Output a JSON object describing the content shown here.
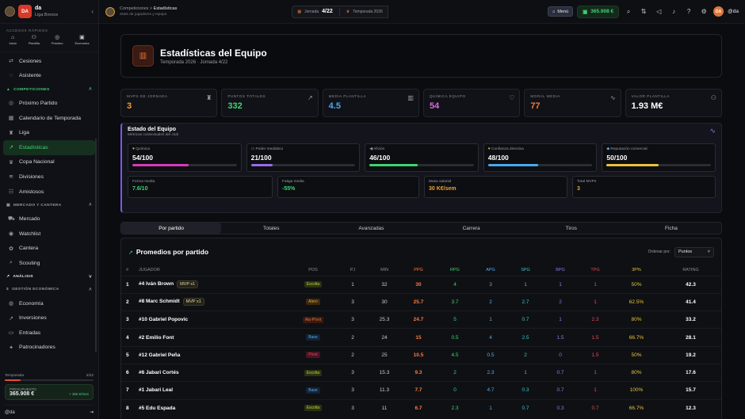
{
  "sidebar": {
    "club_logo": "DA",
    "club_name": "da",
    "club_league": "Liga Bronce",
    "quick_access_title": "ACCESOS RÁPIDOS",
    "quick_access": [
      {
        "label": "Inicio",
        "icon": "home-icon"
      },
      {
        "label": "Plantilla",
        "icon": "users-icon"
      },
      {
        "label": "Próximo",
        "icon": "ball-icon"
      },
      {
        "label": "Economía",
        "icon": "wallet-icon"
      }
    ],
    "items_top": [
      {
        "label": "Cesiones",
        "icon": "swap-icon"
      },
      {
        "label": "Asistente",
        "icon": "assistant-icon"
      }
    ],
    "section_competitions": "COMPETICIONES",
    "items_comp": [
      {
        "label": "Próximo Partido",
        "icon": "ball-icon"
      },
      {
        "label": "Calendario de Temporada",
        "icon": "calendar-icon"
      },
      {
        "label": "Liga",
        "icon": "trophy-icon"
      },
      {
        "label": "Estadísticas",
        "icon": "chart-icon"
      },
      {
        "label": "Copa Nacional",
        "icon": "cup-icon"
      },
      {
        "label": "Divisiones",
        "icon": "layers-icon"
      },
      {
        "label": "Amistosos",
        "icon": "handshake-icon"
      }
    ],
    "section_market": "MERCADO Y CANTERA",
    "items_market": [
      {
        "label": "Mercado",
        "icon": "cart-icon"
      },
      {
        "label": "Watchlist",
        "icon": "eye-icon"
      },
      {
        "label": "Cantera",
        "icon": "sprout-icon"
      },
      {
        "label": "Scouting",
        "icon": "search-icon"
      }
    ],
    "section_analysis": "ANÁLISIS",
    "section_economy": "GESTIÓN ECONÓMICA",
    "items_economy": [
      {
        "label": "Economía",
        "icon": "coin-icon"
      },
      {
        "label": "Inversiones",
        "icon": "trend-icon"
      },
      {
        "label": "Entradas",
        "icon": "ticket-icon"
      },
      {
        "label": "Patrocinadores",
        "icon": "badge-icon"
      }
    ],
    "season_label": "Temporada",
    "season_progress": "4/22",
    "season_fraction": 0.18,
    "budget_label": "PRESUPUESTO",
    "budget_value": "365.908 €",
    "budget_delta": "+ 366 €/mes",
    "user": "@da"
  },
  "topbar": {
    "crumb_parent": "Competiciones",
    "crumb_sep": ">",
    "crumb_current": "Estadísticas",
    "subtitle": "Stats de jugadores y equipo",
    "jornada_label": "Jornada",
    "jornada_value": "4/22",
    "season_label": "Temporada 2026",
    "menu_label": "Menú",
    "money": "365.908 €",
    "avatar": "DA",
    "user": "@da"
  },
  "hero": {
    "title": "Estadísticas del Equipo",
    "subtitle": "Temporada 2026 · Jornada 4/22"
  },
  "kpis": [
    {
      "label": "MVPS DE JORNADA",
      "value": "3",
      "color": "#f0a030",
      "icon": "trophy-icon"
    },
    {
      "label": "PUNTOS TOTALES",
      "value": "332",
      "color": "#3fd472",
      "icon": "trend-up-icon"
    },
    {
      "label": "MEDIA PLANTILLA",
      "value": "4.5",
      "color": "#4aa8f0",
      "icon": "bar-chart-icon"
    },
    {
      "label": "QUÍMICA EQUIPO",
      "value": "54",
      "color": "#d86ae0",
      "icon": "heart-icon"
    },
    {
      "label": "MORAL MEDIA",
      "value": "77",
      "color": "#f07a30",
      "icon": "pulse-icon"
    },
    {
      "label": "VALOR PLANTILLA",
      "value": "1.93 M€",
      "color": "#ffffff",
      "icon": "users-icon"
    }
  ],
  "state": {
    "title": "Estado del Equipo",
    "subtitle": "Métricas contextuales del club",
    "gauges": [
      {
        "label": "Química",
        "value": "54/100",
        "fraction": 0.54,
        "color": "#d83ab8",
        "icon": "heart-icon"
      },
      {
        "label": "Poder mediático",
        "value": "21/100",
        "fraction": 0.21,
        "color": "#9a6ae8",
        "icon": "tv-icon"
      },
      {
        "label": "Afición",
        "value": "46/100",
        "fraction": 0.46,
        "color": "#3fd472",
        "icon": "megaphone-icon"
      },
      {
        "label": "Confianza directiva",
        "value": "48/100",
        "fraction": 0.48,
        "color": "#4aa8f0",
        "icon": "briefcase-icon"
      },
      {
        "label": "Reputación comercial",
        "value": "50/100",
        "fraction": 0.5,
        "color": "#e8c23a",
        "icon": "diamond-icon"
      }
    ],
    "minis": [
      {
        "label": "Forma media",
        "value": "7.6/10",
        "color": "#3fd472"
      },
      {
        "label": "Fatiga media",
        "value": "-55%",
        "color": "#3fd472"
      },
      {
        "label": "Masa salarial",
        "value": "30 K€/sem",
        "color": "#f0a030"
      },
      {
        "label": "Total MVPs",
        "value": "3",
        "color": "#f0a030"
      }
    ]
  },
  "tabs": [
    "Por partido",
    "Totales",
    "Avanzadas",
    "Carrera",
    "Tiros",
    "Ficha"
  ],
  "table": {
    "title": "Promedios por partido",
    "sort_label": "Ordenar por:",
    "sort_value": "Puntos",
    "headers": [
      "#",
      "JUGADOR",
      "POS",
      "PJ",
      "MIN",
      "PPG",
      "RPG",
      "APG",
      "SPG",
      "BPG",
      "TPG",
      "3P%",
      "RATING"
    ],
    "rows": [
      {
        "rank": "1",
        "name": "#4 Iván Brown",
        "mvp": "MVP x1",
        "pos": "Escolta",
        "pc": "esc",
        "pj": "1",
        "min": "32",
        "ppg": "30",
        "rpg": "4",
        "apg": "3",
        "spg": "1",
        "bpg": "1",
        "tpg": "1",
        "tp": "50%",
        "rt": "42.3"
      },
      {
        "rank": "2",
        "name": "#8 Marc Schmidt",
        "mvp": "MVP x1",
        "pos": "Alero",
        "pc": "ale",
        "pj": "3",
        "min": "30",
        "ppg": "25.7",
        "rpg": "3.7",
        "apg": "2",
        "spg": "2.7",
        "bpg": "2",
        "tpg": "1",
        "tp": "62.5%",
        "rt": "41.4"
      },
      {
        "rank": "3",
        "name": "#10 Gabriel Popovic",
        "mvp": "",
        "pos": "Ala-Pívot",
        "pc": "ap",
        "pj": "3",
        "min": "25.3",
        "ppg": "24.7",
        "rpg": "5",
        "apg": "1",
        "spg": "0.7",
        "bpg": "1",
        "tpg": "2.3",
        "tp": "80%",
        "rt": "33.2"
      },
      {
        "rank": "4",
        "name": "#2 Emilio Font",
        "mvp": "",
        "pos": "Base",
        "pc": "bas",
        "pj": "2",
        "min": "24",
        "ppg": "15",
        "rpg": "0.5",
        "apg": "4",
        "spg": "2.5",
        "bpg": "1.5",
        "tpg": "1.5",
        "tp": "66.7%",
        "rt": "28.1"
      },
      {
        "rank": "5",
        "name": "#12 Gabriel Peña",
        "mvp": "",
        "pos": "Pívot",
        "pc": "piv",
        "pj": "2",
        "min": "25",
        "ppg": "10.5",
        "rpg": "4.5",
        "apg": "0.5",
        "spg": "2",
        "bpg": "0",
        "tpg": "1.5",
        "tp": "50%",
        "rt": "19.2"
      },
      {
        "rank": "6",
        "name": "#6 Jabari Cortés",
        "mvp": "",
        "pos": "Escolta",
        "pc": "esc",
        "pj": "3",
        "min": "15.3",
        "ppg": "9.3",
        "rpg": "2",
        "apg": "2.3",
        "spg": "1",
        "bpg": "0.7",
        "tpg": "1",
        "tp": "80%",
        "rt": "17.6"
      },
      {
        "rank": "7",
        "name": "#1 Jabari Leal",
        "mvp": "",
        "pos": "Base",
        "pc": "bas",
        "pj": "3",
        "min": "11.3",
        "ppg": "7.7",
        "rpg": "0",
        "apg": "4.7",
        "spg": "0.3",
        "bpg": "0.7",
        "tpg": "1",
        "tp": "100%",
        "rt": "15.7"
      },
      {
        "rank": "8",
        "name": "#5 Edu Espada",
        "mvp": "",
        "pos": "Escolta",
        "pc": "esc",
        "pj": "3",
        "min": "11",
        "ppg": "6.7",
        "rpg": "2.3",
        "apg": "1",
        "spg": "0.7",
        "bpg": "0.3",
        "tpg": "0.7",
        "tp": "66.7%",
        "rt": "12.3"
      }
    ]
  }
}
